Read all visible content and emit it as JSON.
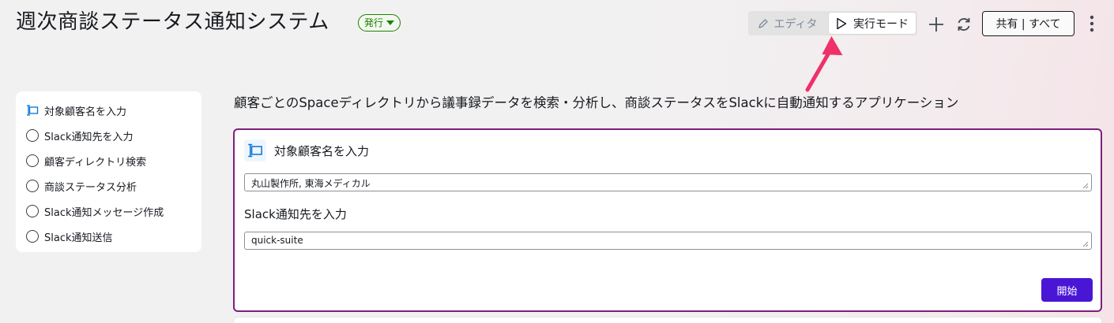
{
  "header": {
    "title": "週次商談ステータス通知システム",
    "badge_label": "発行",
    "mode_edit_label": "エディタ",
    "mode_run_label": "実行モード",
    "share_label": "共有 | すべて"
  },
  "sidebar": {
    "steps": [
      {
        "label": "対象顧客名を入力",
        "icon": "input-step-icon"
      },
      {
        "label": "Slack通知先を入力",
        "icon": "circle"
      },
      {
        "label": "顧客ディレクトリ検索",
        "icon": "circle"
      },
      {
        "label": "商談ステータス分析",
        "icon": "circle"
      },
      {
        "label": "Slack通知メッセージ作成",
        "icon": "circle"
      },
      {
        "label": "Slack通知送信",
        "icon": "circle"
      }
    ]
  },
  "main": {
    "description": "顧客ごとのSpaceディレクトリから議事録データを検索・分析し、商談ステータスをSlackに自動通知するアプリケーション",
    "panel": {
      "title": "対象顧客名を入力",
      "customer_value": "丸山製作所, 東海メディカル",
      "slack_label": "Slack通知先を入力",
      "slack_value": "quick-suite",
      "start_label": "開始"
    }
  },
  "colors": {
    "accent": "#4a16d6",
    "panel_border": "#7d1f7e",
    "badge_green": "#1d8102",
    "arrow": "#f0306a"
  }
}
